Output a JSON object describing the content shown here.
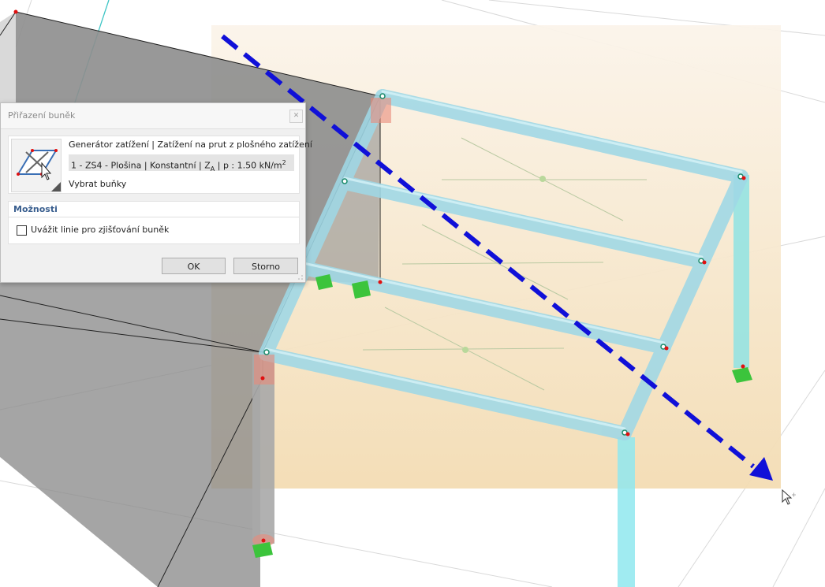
{
  "dialog": {
    "title": "Přiřazení buněk",
    "close_symbol": "✕",
    "generator_text": "Generátor zatížení | Zatížení na prut z plošného zatížení",
    "load_case_text": "1 - ZS4 - Plošina | Konstantní | Z",
    "load_case_axis_sub": "A",
    "load_case_value_text": " | p : 1.50 kN/m",
    "load_case_unit_sup": "2",
    "select_cells_label": "Vybrat buňky",
    "select_cells_icon": "select-cells-icon",
    "options_header": "Možnosti",
    "checkbox_label": "Uvážit linie pro zjišťování buněk",
    "checkbox_checked": false,
    "ok_label": "OK",
    "cancel_label": "Storno"
  },
  "colors": {
    "accent_header": "#3a5f8f",
    "member": "#9fd8e6",
    "support": "#3cc43c",
    "selection_area": "#f3dfba",
    "arrow": "#1010d8",
    "wall": "#8e8e8e"
  }
}
